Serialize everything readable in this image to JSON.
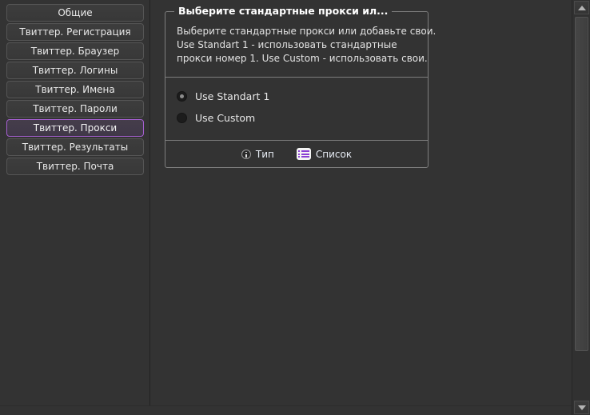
{
  "sidebar": {
    "items": [
      {
        "label": "Общие",
        "selected": false
      },
      {
        "label": "Твиттер. Регистрация",
        "selected": false
      },
      {
        "label": "Твиттер. Браузер",
        "selected": false
      },
      {
        "label": "Твиттер. Логины",
        "selected": false
      },
      {
        "label": "Твиттер. Имена",
        "selected": false
      },
      {
        "label": "Твиттер. Пароли",
        "selected": false
      },
      {
        "label": "Твиттер. Прокси",
        "selected": true
      },
      {
        "label": "Твиттер. Результаты",
        "selected": false
      },
      {
        "label": "Твиттер. Почта",
        "selected": false
      }
    ]
  },
  "group": {
    "legend": "Выберите стандартные прокси ил...",
    "description_lines": [
      "Выберите стандартные прокси или добавьте свои.",
      "Use Standart 1 - использовать стандартные",
      "прокси номер 1. Use Custom - использовать свои."
    ],
    "options": [
      {
        "label": "Use Standart 1",
        "checked": true
      },
      {
        "label": "Use Custom",
        "checked": false
      }
    ],
    "toolbar": [
      {
        "label": "Тип",
        "icon": "info-icon"
      },
      {
        "label": "Список",
        "icon": "list-icon"
      }
    ]
  },
  "colors": {
    "accent": "#a55fd0",
    "icon_purple": "#8b3fd4",
    "background": "#333333",
    "border": "#7d7d7d"
  }
}
